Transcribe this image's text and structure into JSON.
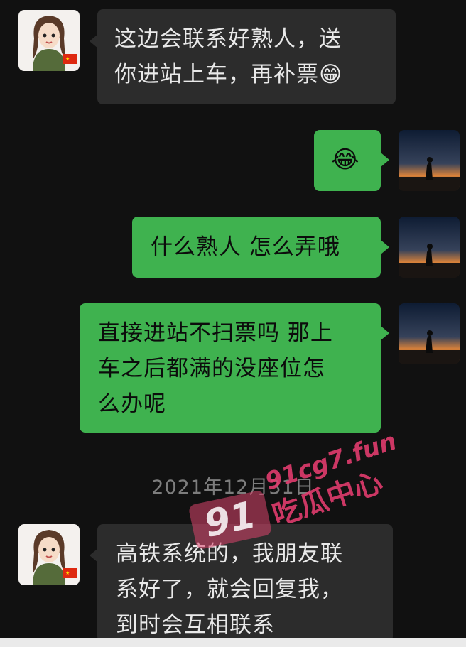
{
  "messages": [
    {
      "side": "in",
      "text": "这边会联系好熟人，送\n你进站上车，再补票😁"
    },
    {
      "side": "out",
      "text": "😂"
    },
    {
      "side": "out",
      "text": "什么熟人 怎么弄哦"
    },
    {
      "side": "out",
      "text": "直接进站不扫票吗 那上\n车之后都满的没座位怎\n么办呢"
    },
    {
      "side": "in",
      "text": "高铁系统的，我朋友联\n系好了，就会回复我，\n到时会互相联系"
    }
  ],
  "timestamp": "2021年12月31日",
  "watermark": {
    "badge": "91",
    "url": "91cg7.fun",
    "name": "吃瓜中心"
  },
  "colors": {
    "background": "#111111",
    "incoming": "#2c2c2c",
    "outgoing": "#3fb24f"
  }
}
